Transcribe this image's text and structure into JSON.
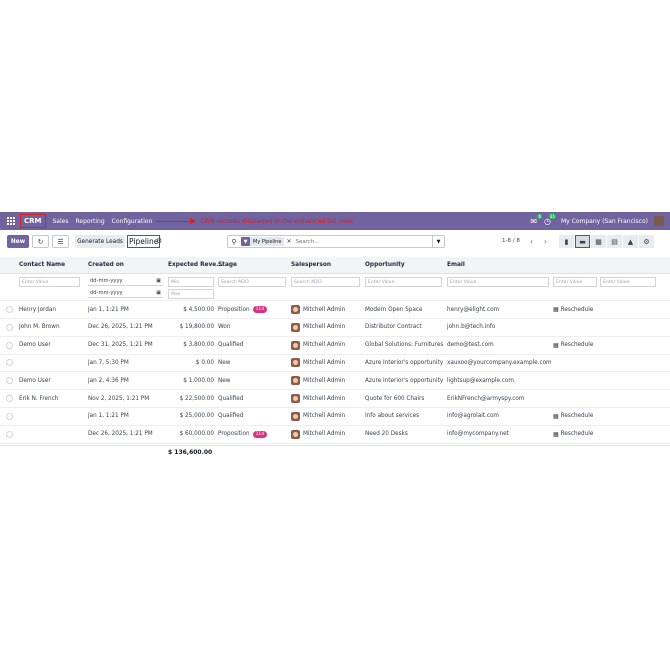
{
  "nav": {
    "app": "CRM",
    "menu": [
      "Sales",
      "Reporting",
      "Configuration"
    ],
    "annotation": "CRM records displayed in the enhanced list view.",
    "chat_badge": "6",
    "activity_badge": "31",
    "company": "My Company (San Francisco)"
  },
  "control": {
    "new_label": "New",
    "generate_leads_label": "Generate Leads",
    "breadcrumb": "Pipeline",
    "facet_label": "My Pipeline",
    "search_placeholder": "Search...",
    "pager": "1-8 / 8"
  },
  "table": {
    "headers": [
      "Contact Name",
      "Created on",
      "Expected Reve...",
      "Stage",
      "Salesperson",
      "Opportunity",
      "Email"
    ],
    "filters": {
      "contact": "Enter Value",
      "date_placeholder": "dd-mm-yyyy",
      "min": "Min",
      "max": "Max",
      "stage": "Search M2O",
      "salesperson": "Search M2O",
      "opportunity": "Enter Value",
      "email": "Enter Value",
      "extra1": "Enter Value",
      "extra2": "Enter Value",
      "extra3": "Enter Value"
    },
    "rows": [
      {
        "contact": "Henry Jordan",
        "created": "Jan 1, 1:21 PM",
        "revenue": "$ 4,500.00",
        "stage": "Proposition",
        "tag": "114",
        "salesperson": "Mitchell Admin",
        "opportunity": "Modern Open Space",
        "email": "henry@elight.com",
        "activity": "Reschedule"
      },
      {
        "contact": "John M. Brown",
        "created": "Dec 26, 2025, 1:21 PM",
        "revenue": "$ 19,800.00",
        "stage": "Won",
        "tag": "",
        "salesperson": "Mitchell Admin",
        "opportunity": "Distributor Contract",
        "email": "john.b@tech.info",
        "activity": ""
      },
      {
        "contact": "Demo User",
        "created": "Dec 31, 2025, 1:21 PM",
        "revenue": "$ 3,800.00",
        "stage": "Qualified",
        "tag": "",
        "salesperson": "Mitchell Admin",
        "opportunity": "Global Solutions: Furnitures",
        "email": "demo@test.com",
        "activity": "Reschedule"
      },
      {
        "contact": "",
        "created": "Jan 7, 5:30 PM",
        "revenue": "$ 0.00",
        "stage": "New",
        "tag": "",
        "salesperson": "Mitchell Admin",
        "opportunity": "Azure Interior's opportunity",
        "email": "xauxoo@yourcompany.example.com",
        "activity": ""
      },
      {
        "contact": "Demo User",
        "created": "Jan 2, 4:36 PM",
        "revenue": "$ 1,000.00",
        "stage": "New",
        "tag": "",
        "salesperson": "Mitchell Admin",
        "opportunity": "Azure Interior's opportunity",
        "email": "lightsup@example.com",
        "activity": ""
      },
      {
        "contact": "Erik N. French",
        "created": "Nov 2, 2025, 1:21 PM",
        "revenue": "$ 22,500.00",
        "stage": "Qualified",
        "tag": "",
        "salesperson": "Mitchell Admin",
        "opportunity": "Quote for 600 Chairs",
        "email": "ErikNFrench@armyspy.com",
        "activity": ""
      },
      {
        "contact": "",
        "created": "Jan 1, 1:21 PM",
        "revenue": "$ 25,000.00",
        "stage": "Qualified",
        "tag": "",
        "salesperson": "Mitchell Admin",
        "opportunity": "Info about services",
        "email": "info@agrolait.com",
        "activity": "Reschedule"
      },
      {
        "contact": "",
        "created": "Dec 26, 2025, 1:21 PM",
        "revenue": "$ 60,000.00",
        "stage": "Proposition",
        "tag": "114",
        "salesperson": "Mitchell Admin",
        "opportunity": "Need 20 Desks",
        "email": "info@mycompany.net",
        "activity": "Reschedule"
      }
    ],
    "total": "$ 136,600.00"
  },
  "colors": {
    "brand": "#71639e",
    "annotation_red": "#e11d1d",
    "tag_pink": "#d63384"
  }
}
